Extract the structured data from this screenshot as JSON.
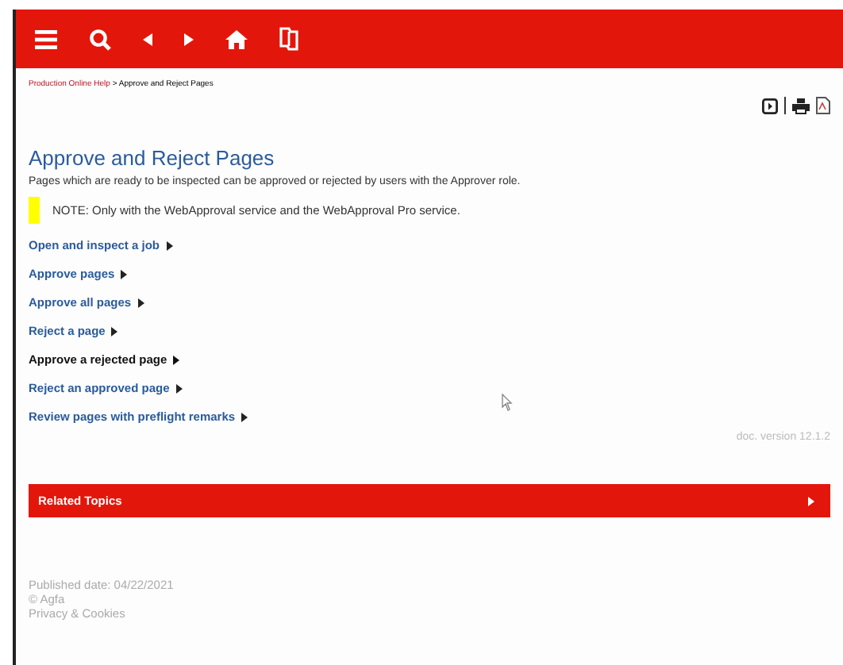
{
  "breadcrumb": {
    "parent": "Production Online Help",
    "separator": ">",
    "current": "Approve and Reject Pages"
  },
  "title": "Approve and Reject Pages",
  "intro": "Pages which are ready to be inspected can be approved or rejected by users with the Approver role.",
  "note": "NOTE: Only with the WebApproval service and the WebApproval Pro service.",
  "links": [
    {
      "label": "Open and inspect a job",
      "hovered": false
    },
    {
      "label": "Approve pages",
      "hovered": false
    },
    {
      "label": "Approve all pages",
      "hovered": false
    },
    {
      "label": "Reject a page",
      "hovered": false
    },
    {
      "label": "Approve a rejected page",
      "hovered": true
    },
    {
      "label": "Reject an approved page",
      "hovered": false
    },
    {
      "label": "Review pages with preflight remarks",
      "hovered": false
    }
  ],
  "doc_version": "doc. version 12.1.2",
  "related_topics": {
    "label": "Related Topics",
    "expanded": false
  },
  "footer": [
    "Published date: 04/22/2021",
    "© Agfa",
    "Privacy & Cookies"
  ]
}
